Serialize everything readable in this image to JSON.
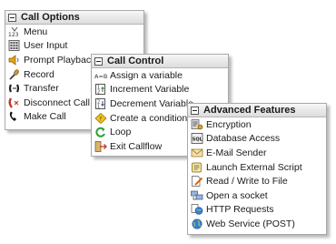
{
  "panels": {
    "call_options": {
      "title": "Call Options",
      "items": [
        {
          "label": "Menu",
          "icon": "menu-123-icon"
        },
        {
          "label": "User Input",
          "icon": "keypad-icon"
        },
        {
          "label": "Prompt Playback",
          "icon": "speaker-icon"
        },
        {
          "label": "Record",
          "icon": "microphone-icon"
        },
        {
          "label": "Transfer",
          "icon": "transfer-phone-icon"
        },
        {
          "label": "Disconnect Call",
          "icon": "hangup-phone-icon"
        },
        {
          "label": "Make Call",
          "icon": "phone-handset-icon"
        }
      ]
    },
    "call_control": {
      "title": "Call Control",
      "items": [
        {
          "label": "Assign a variable",
          "icon": "a-equals-b-icon"
        },
        {
          "label": "Increment Variable",
          "icon": "increment-icon"
        },
        {
          "label": "Decrement Variable",
          "icon": "decrement-icon"
        },
        {
          "label": "Create a condition",
          "icon": "condition-diamond-icon"
        },
        {
          "label": "Loop",
          "icon": "loop-arrow-icon"
        },
        {
          "label": "Exit Callflow",
          "icon": "exit-icon"
        }
      ]
    },
    "advanced_features": {
      "title": "Advanced Features",
      "items": [
        {
          "label": "Encryption",
          "icon": "encryption-icon"
        },
        {
          "label": "Database Access",
          "icon": "database-icon"
        },
        {
          "label": "E-Mail Sender",
          "icon": "envelope-icon"
        },
        {
          "label": "Launch External Script",
          "icon": "script-icon"
        },
        {
          "label": "Read / Write to File",
          "icon": "file-edit-icon"
        },
        {
          "label": "Open a socket",
          "icon": "socket-icon"
        },
        {
          "label": "HTTP Requests",
          "icon": "http-globe-icon"
        },
        {
          "label": "Web Service (POST)",
          "icon": "web-service-globe-icon"
        }
      ]
    }
  }
}
